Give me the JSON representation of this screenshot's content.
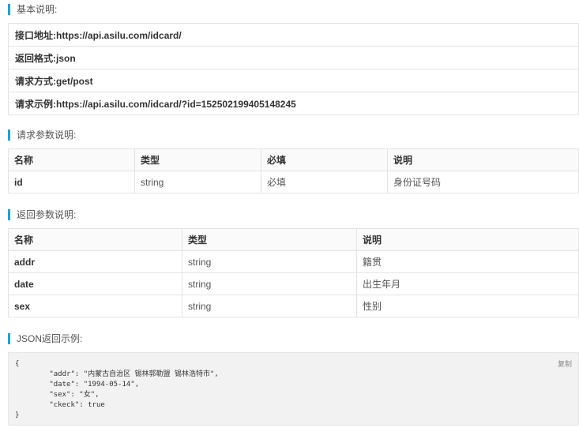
{
  "basic": {
    "title": "基本说明:",
    "rows": [
      {
        "label": "接口地址:",
        "value": "https://api.asilu.com/idcard/"
      },
      {
        "label": "返回格式:",
        "value": "json"
      },
      {
        "label": "请求方式:",
        "value": "get/post"
      },
      {
        "label": "请求示例:",
        "value": "https://api.asilu.com/idcard/?id=152502199405148245"
      }
    ]
  },
  "request_params": {
    "title": "请求参数说明:",
    "headers": [
      "名称",
      "类型",
      "必填",
      "说明"
    ],
    "rows": [
      {
        "name": "id",
        "type": "string",
        "required": "必填",
        "desc": "身份证号码"
      }
    ]
  },
  "response_params": {
    "title": "返回参数说明:",
    "headers": [
      "名称",
      "类型",
      "说明"
    ],
    "rows": [
      {
        "name": "addr",
        "type": "string",
        "desc": "籍贯"
      },
      {
        "name": "date",
        "type": "string",
        "desc": "出生年月"
      },
      {
        "name": "sex",
        "type": "string",
        "desc": "性别"
      }
    ]
  },
  "json_example": {
    "title": "JSON返回示例:",
    "copy_label": "复制",
    "code": "{\n        \"addr\": \"内蒙古自治区 锡林郭勒盟 锡林浩特市\",\n        \"date\": \"1994-05-14\",\n        \"sex\": \"女\",\n        \"ckeck\": true\n}"
  },
  "colors": {
    "accent": "#1ba1e2",
    "border": "#e3e3e3",
    "code_bg": "#f2f2f2"
  }
}
